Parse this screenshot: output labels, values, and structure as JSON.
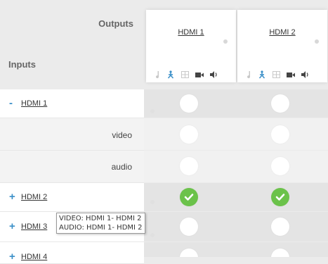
{
  "matrix": {
    "outputs_label": "Outputs",
    "inputs_label": "Inputs",
    "outputs": [
      {
        "label": "HDMI 1"
      },
      {
        "label": "HDMI 2"
      }
    ],
    "output_controls": [
      "audio-note-icon",
      "route-icon",
      "grid-icon",
      "video-camera-icon",
      "speaker-icon"
    ],
    "inputs": [
      {
        "sign": "-",
        "label": "HDMI 1",
        "expanded": true,
        "sub_rows": [
          "video",
          "audio"
        ]
      },
      {
        "sign": "+",
        "label": "HDMI 2",
        "expanded": false
      },
      {
        "sign": "+",
        "label": "HDMI 3",
        "expanded": false
      },
      {
        "sign": "+",
        "label": "HDMI 4",
        "expanded": false
      }
    ],
    "routes_checked": [
      {
        "input": "HDMI 2",
        "output": "HDMI 1"
      },
      {
        "input": "HDMI 2",
        "output": "HDMI 2"
      }
    ],
    "colors": {
      "accent": "#3a8fc8",
      "checked": "#6bc24a",
      "background": "#ebebeb"
    }
  },
  "tooltip": {
    "line1": "VIDEO: HDMI 1- HDMI 2",
    "line2": "AUDIO: HDMI 1- HDMI 2"
  }
}
